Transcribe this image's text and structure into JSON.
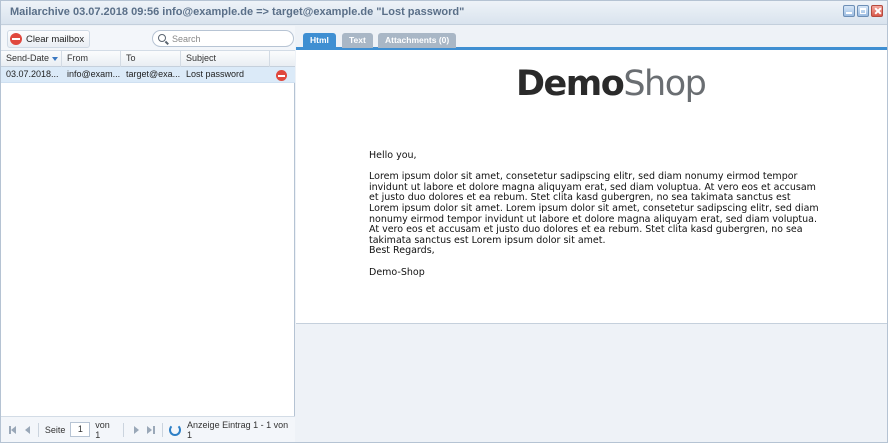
{
  "window": {
    "title": "Mailarchive 03.07.2018 09:56 info@example.de => target@example.de \"Lost password\""
  },
  "toolbar": {
    "clear_label": "Clear mailbox",
    "search_placeholder": "Search"
  },
  "grid": {
    "columns": [
      "Send-Date",
      "From",
      "To",
      "Subject"
    ],
    "rows": [
      {
        "date": "03.07.2018...",
        "from": "info@exam...",
        "to": "target@exa...",
        "subject": "Lost password"
      }
    ]
  },
  "pager": {
    "page_label": "Seite",
    "page_value": "1",
    "of_label": "von 1",
    "info": "Anzeige Eintrag 1 - 1 von 1"
  },
  "tabs": [
    "Html",
    "Text",
    "Attachments (0)"
  ],
  "email": {
    "logo_demo": "Demo",
    "logo_shop": "Shop",
    "greeting": "Hello you,",
    "body": "Lorem ipsum dolor sit amet, consetetur sadipscing elitr, sed diam nonumy eirmod tempor invidunt ut labore et dolore magna aliquyam erat, sed diam voluptua. At vero eos et accusam et justo duo dolores et ea rebum. Stet clita kasd gubergren, no sea takimata sanctus est Lorem ipsum dolor sit amet. Lorem ipsum dolor sit amet, consetetur sadipscing elitr, sed diam nonumy eirmod tempor invidunt ut labore et dolore magna aliquyam erat, sed diam voluptua. At vero eos et accusam et justo duo dolores et ea rebum. Stet clita kasd gubergren, no sea takimata sanctus est Lorem ipsum dolor sit amet.",
    "closing": "Best Regards,",
    "signature": "Demo-Shop"
  },
  "colors": {
    "accent": "#3f8fd2",
    "selected_row": "#dbeaf8",
    "delete": "#e0483e"
  },
  "icons": [
    "delete-icon",
    "search-icon",
    "sort-desc-icon",
    "first-page-icon",
    "prev-page-icon",
    "next-page-icon",
    "last-page-icon",
    "refresh-icon",
    "minimize-icon",
    "maximize-icon",
    "close-icon"
  ]
}
